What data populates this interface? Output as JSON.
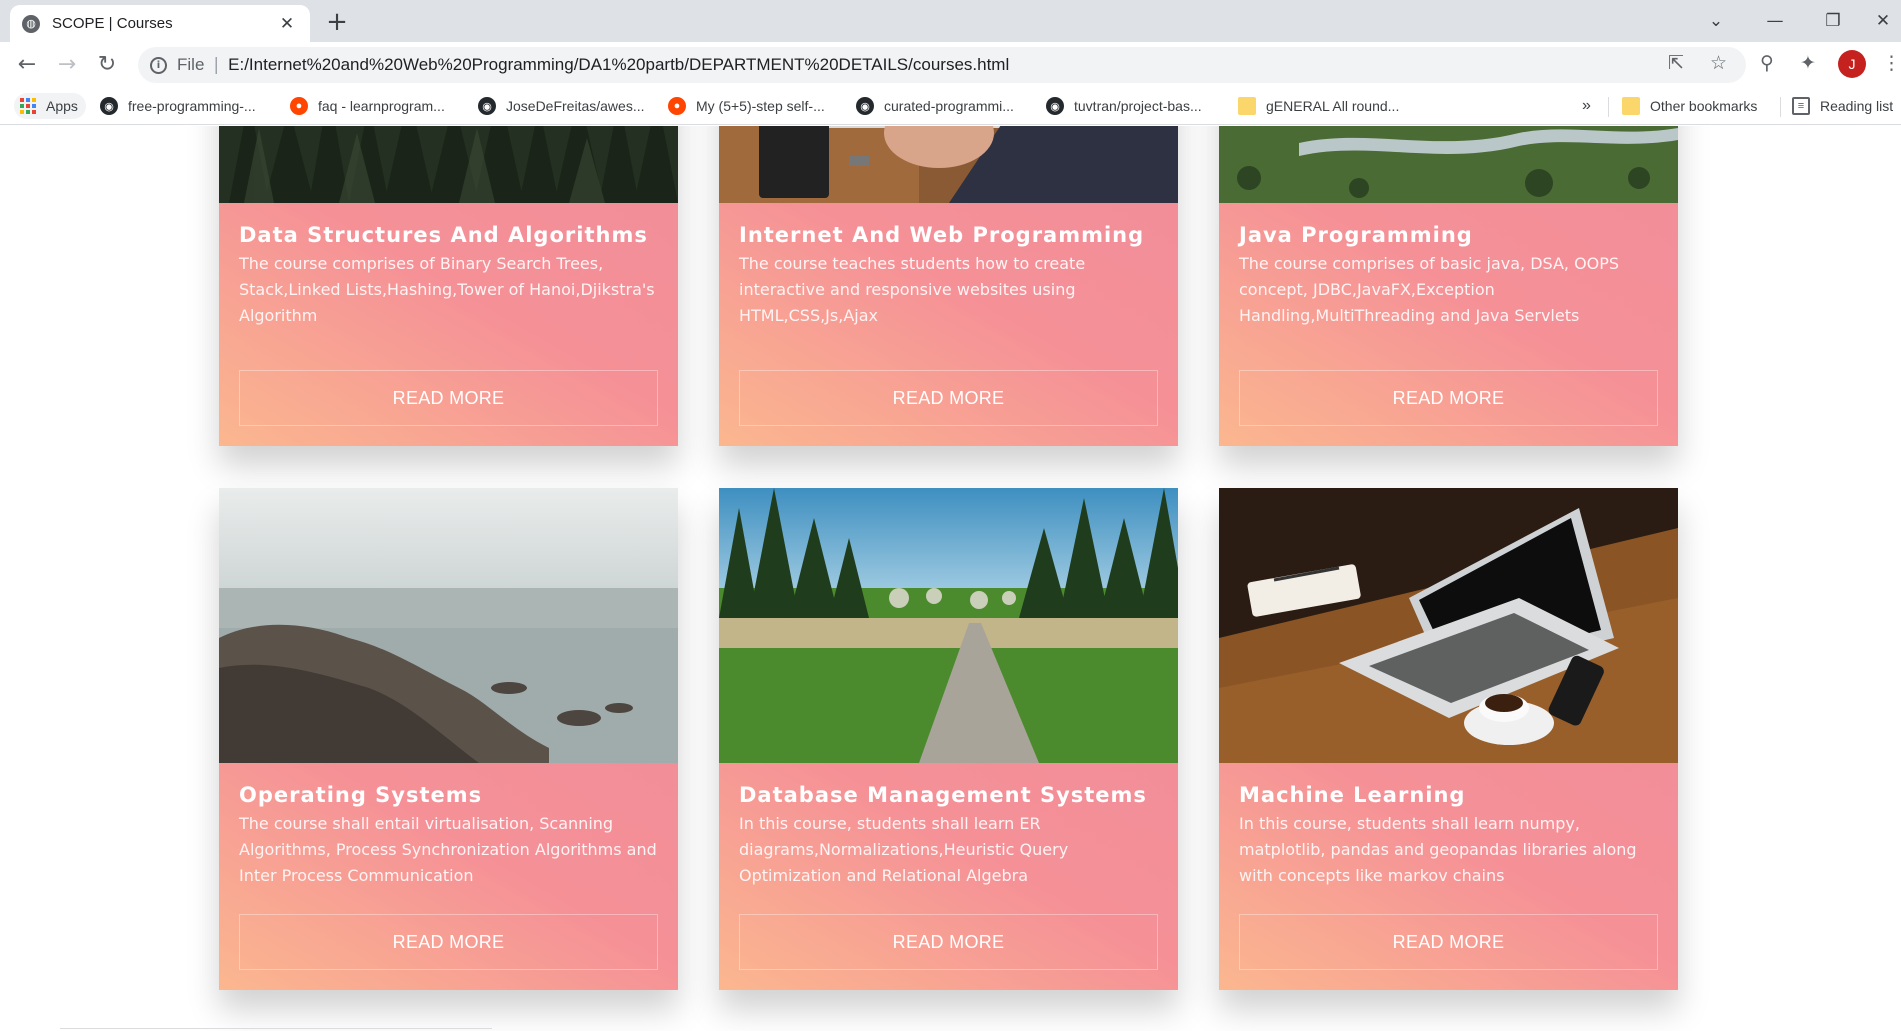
{
  "browser": {
    "tab_title": "SCOPE | Courses",
    "url_scheme": "File",
    "url": "E:/Internet%20and%20Web%20Programming/DA1%20partb/DEPARTMENT%20DETAILS/courses.html",
    "profile_initial": "J"
  },
  "bookmarks": {
    "apps": "Apps",
    "items": [
      {
        "label": "free-programming-...",
        "icon": "github-icon"
      },
      {
        "label": "faq - learnprogram...",
        "icon": "reddit-icon"
      },
      {
        "label": "JoseDeFreitas/awes...",
        "icon": "github-icon"
      },
      {
        "label": "My (5+5)-step self-...",
        "icon": "reddit-icon"
      },
      {
        "label": "curated-programmi...",
        "icon": "github-icon"
      },
      {
        "label": "tuvtran/project-bas...",
        "icon": "github-icon"
      },
      {
        "label": "gENERAL All round...",
        "icon": "folder-icon"
      }
    ],
    "overflow": "»",
    "other": "Other bookmarks",
    "reading_list": "Reading list"
  },
  "courses": [
    {
      "title": "Data Structures And Algorithms",
      "desc": "The course comprises of Binary Search Trees, Stack,Linked Lists,Hashing,Tower of Hanoi,Djikstra's Algorithm",
      "button": "READ MORE",
      "image": "forest-image"
    },
    {
      "title": "Internet And Web Programming",
      "desc": "The course teaches students how to create interactive and responsive websites using HTML,CSS,Js,Ajax",
      "button": "READ MORE",
      "image": "laptop-desk-image"
    },
    {
      "title": "Java Programming",
      "desc": "The course comprises of basic java, DSA, OOPS concept, JDBC,JavaFX,Exception Handling,MultiThreading and Java Servlets",
      "button": "READ MORE",
      "image": "river-meadow-image"
    },
    {
      "title": "Operating Systems",
      "desc": "The course shall entail virtualisation, Scanning Algorithms, Process Synchronization Algorithms and Inter Process Communication",
      "button": "READ MORE",
      "image": "rocky-sea-image"
    },
    {
      "title": "Database Management Systems",
      "desc": "In this course, students shall learn ER diagrams,Normalizations,Heuristic Query Optimization and Relational Algebra",
      "button": "READ MORE",
      "image": "forest-path-image"
    },
    {
      "title": "Machine Learning",
      "desc": "In this course, students shall learn numpy, matplotlib, pandas and geopandas libraries along with concepts like markov chains",
      "button": "READ MORE",
      "image": "laptop-coffee-image"
    }
  ]
}
